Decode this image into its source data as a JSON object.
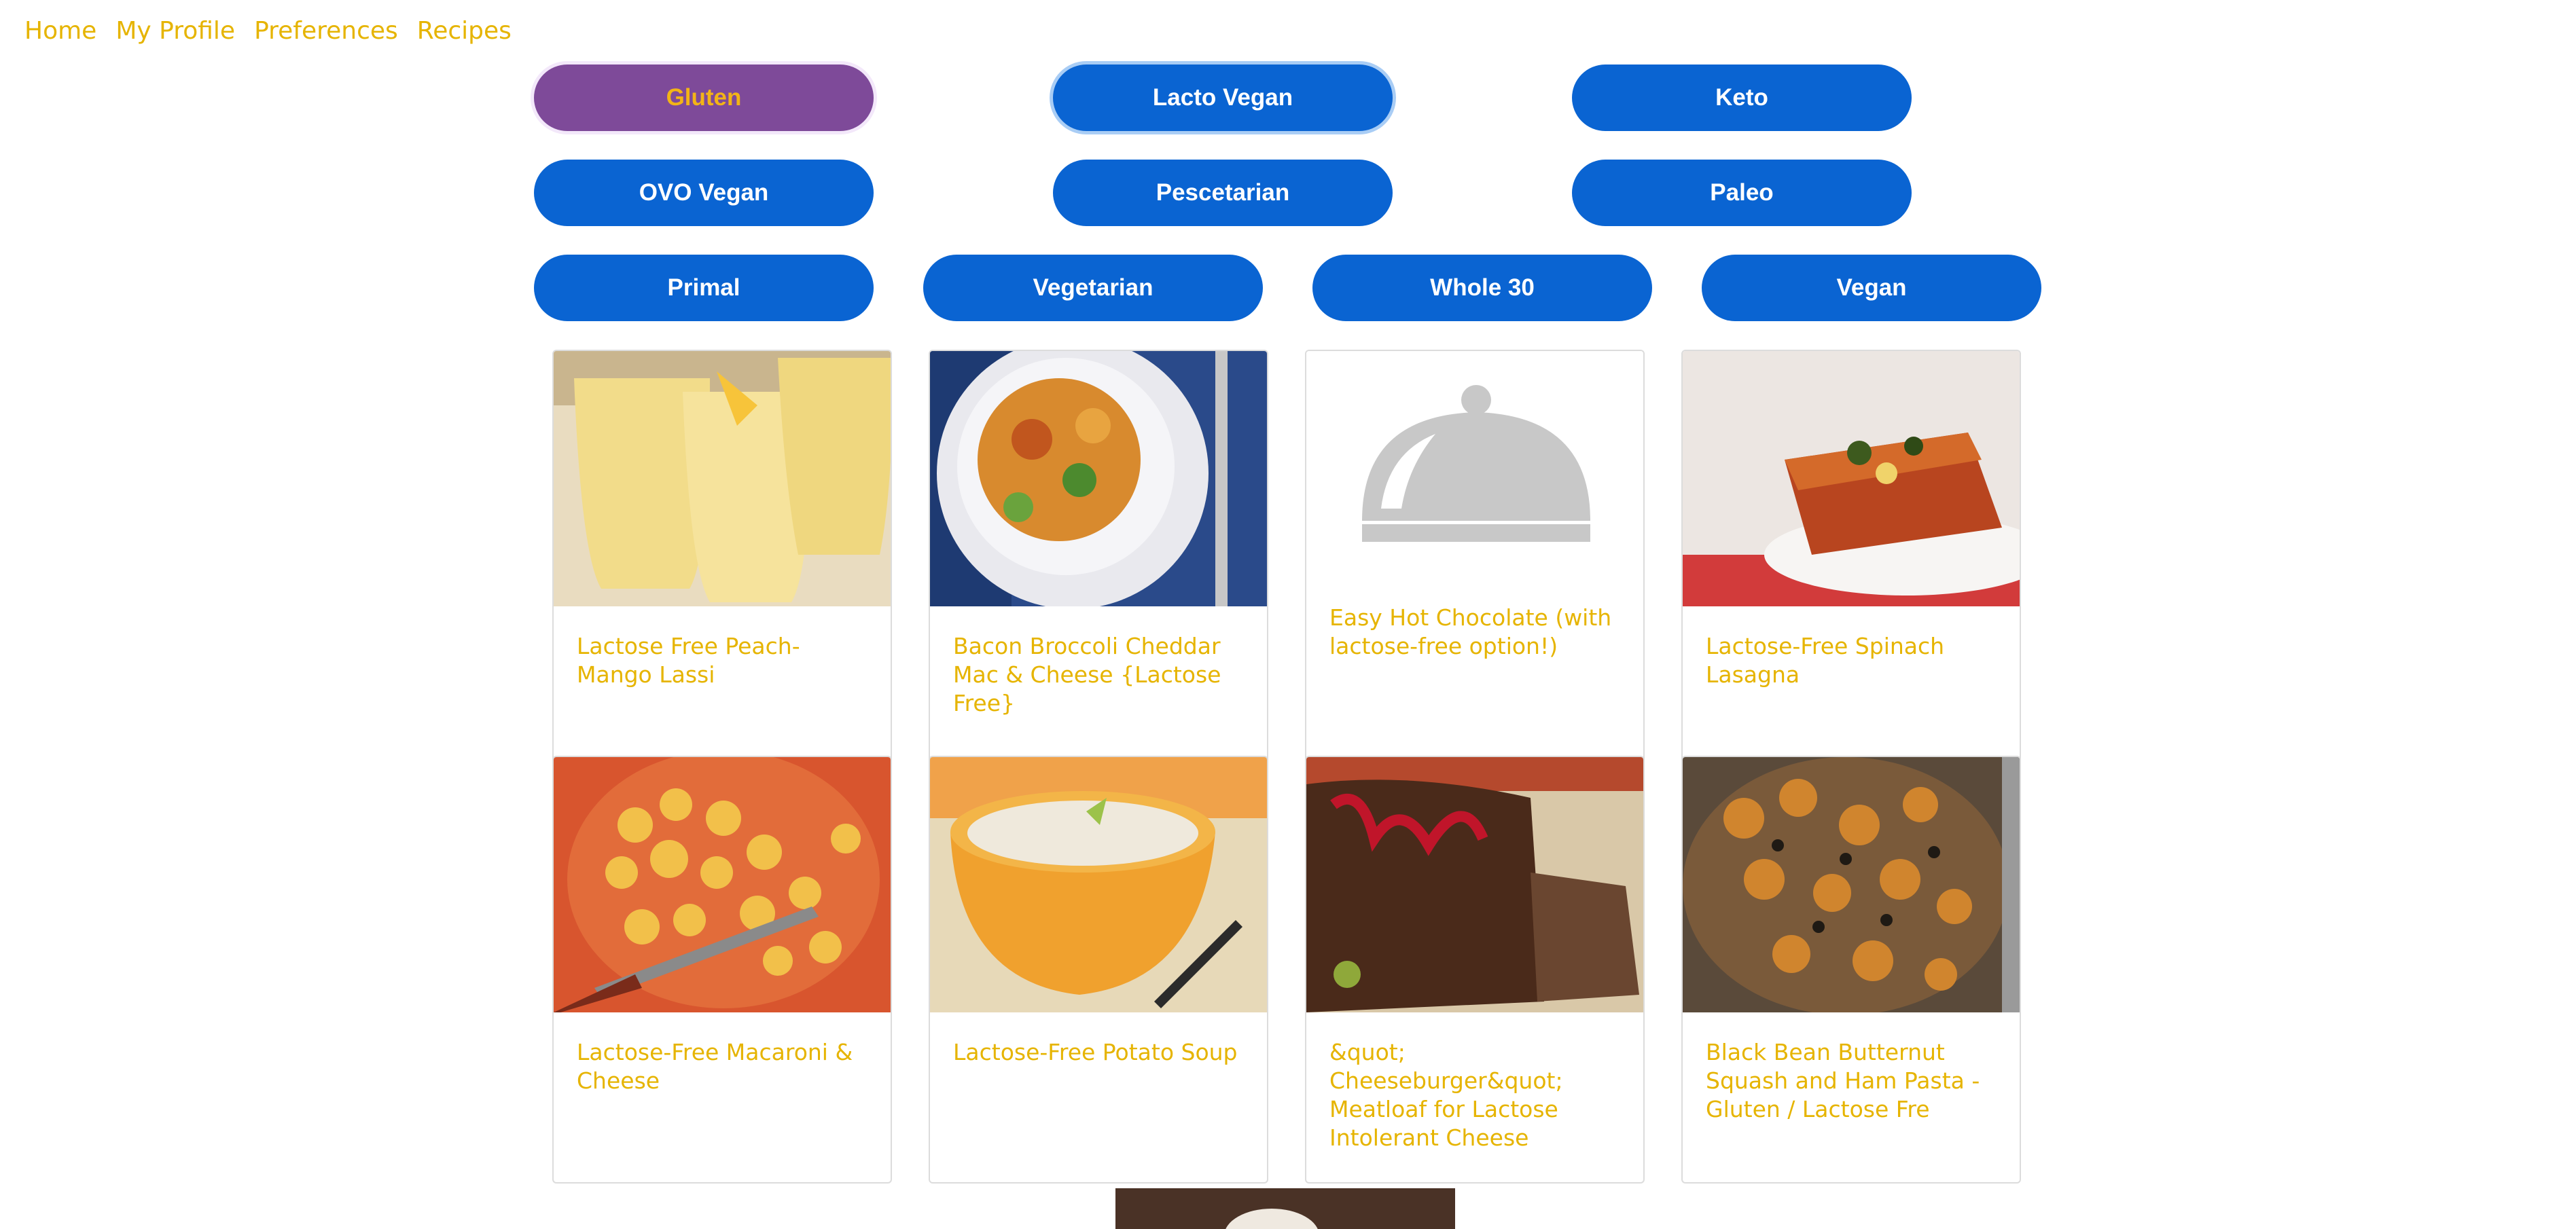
{
  "nav": {
    "items": [
      {
        "label": "Home"
      },
      {
        "label": "My Profile"
      },
      {
        "label": "Preferences"
      },
      {
        "label": "Recipes"
      }
    ]
  },
  "filters": [
    {
      "label": "Gluten",
      "state": "selected"
    },
    {
      "label": "Lacto Vegan",
      "state": "focused"
    },
    {
      "label": "Keto"
    },
    {
      "label": "OVO Vegan"
    },
    {
      "label": "Pescetarian"
    },
    {
      "label": "Paleo"
    },
    {
      "label": "Primal"
    },
    {
      "label": "Vegetarian"
    },
    {
      "label": "Whole 30"
    },
    {
      "label": "Vegan"
    }
  ],
  "recipes": [
    {
      "title": "Lactose Free Peach-Mango Lassi",
      "image": "lassi-photo"
    },
    {
      "title": "Bacon Broccoli Cheddar Mac & Cheese {Lactose Free}",
      "image": "mac-cheese-bowl-photo"
    },
    {
      "title": "Easy Hot Chocolate (with lactose-free option!)",
      "image": "cloche-placeholder-icon"
    },
    {
      "title": "Lactose-Free Spinach Lasagna",
      "image": "lasagna-photo"
    },
    {
      "title": "Lactose-Free Macaroni & Cheese",
      "image": "macaroni-photo"
    },
    {
      "title": "Lactose-Free Potato Soup",
      "image": "potato-soup-photo"
    },
    {
      "title": "&quot; Cheeseburger&quot; Meatloaf for Lactose Intolerant Cheese",
      "image": "meatloaf-photo"
    },
    {
      "title": "Black Bean Butternut Squash and Ham Pasta - Gluten / Lactose Fre",
      "image": "pasta-photo"
    }
  ],
  "colors": {
    "link": "#e6b400",
    "button": "#0a64d2",
    "button_selected": "#7e4a99",
    "button_selected_text": "#f3b416"
  }
}
